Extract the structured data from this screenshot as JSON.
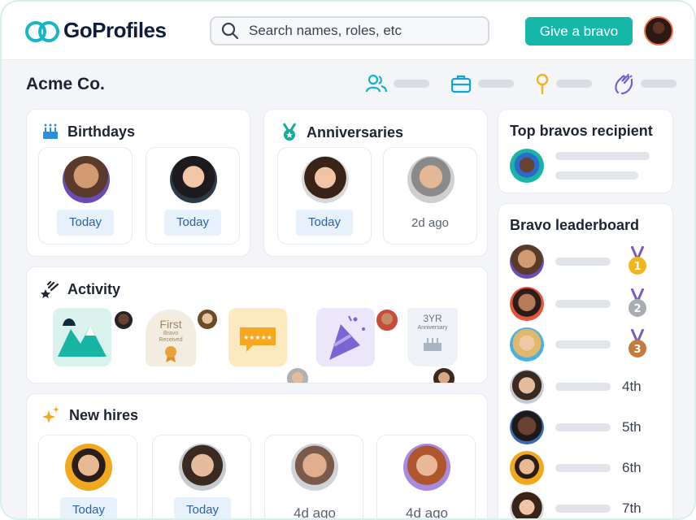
{
  "header": {
    "brand": "GoProfiles",
    "search_placeholder": "Search names, roles, etc",
    "cta_label": "Give a bravo"
  },
  "org": {
    "name": "Acme Co."
  },
  "birthdays": {
    "title": "Birthdays",
    "people": [
      {
        "status": "Today"
      },
      {
        "status": "Today"
      }
    ]
  },
  "anniversaries": {
    "title": "Anniversaries",
    "people": [
      {
        "status": "Today"
      },
      {
        "status": "2d ago"
      }
    ]
  },
  "activity": {
    "title": "Activity",
    "badge_first": "First",
    "badge_first_sub": "Bravo\nReceived",
    "badge_yr": "3YR",
    "badge_anniv": "Anniversary"
  },
  "new_hires": {
    "title": "New hires",
    "people": [
      {
        "status": "Today"
      },
      {
        "status": "Today"
      },
      {
        "status": "4d ago"
      },
      {
        "status": "4d ago"
      }
    ]
  },
  "top_bravos": {
    "title": "Top bravos recipient"
  },
  "leaderboard": {
    "title": "Bravo leaderboard",
    "medals": [
      "1",
      "2",
      "3"
    ],
    "ranks": [
      "4th",
      "5th",
      "6th",
      "7th"
    ],
    "colors": {
      "gold": "#f2b51f",
      "silver": "#a8adb5",
      "bronze": "#c67a3c"
    }
  },
  "colors": {
    "accent": "#15b8a8",
    "today_bg": "#e6f1fc",
    "brand_navy": "#0f1d3a"
  }
}
